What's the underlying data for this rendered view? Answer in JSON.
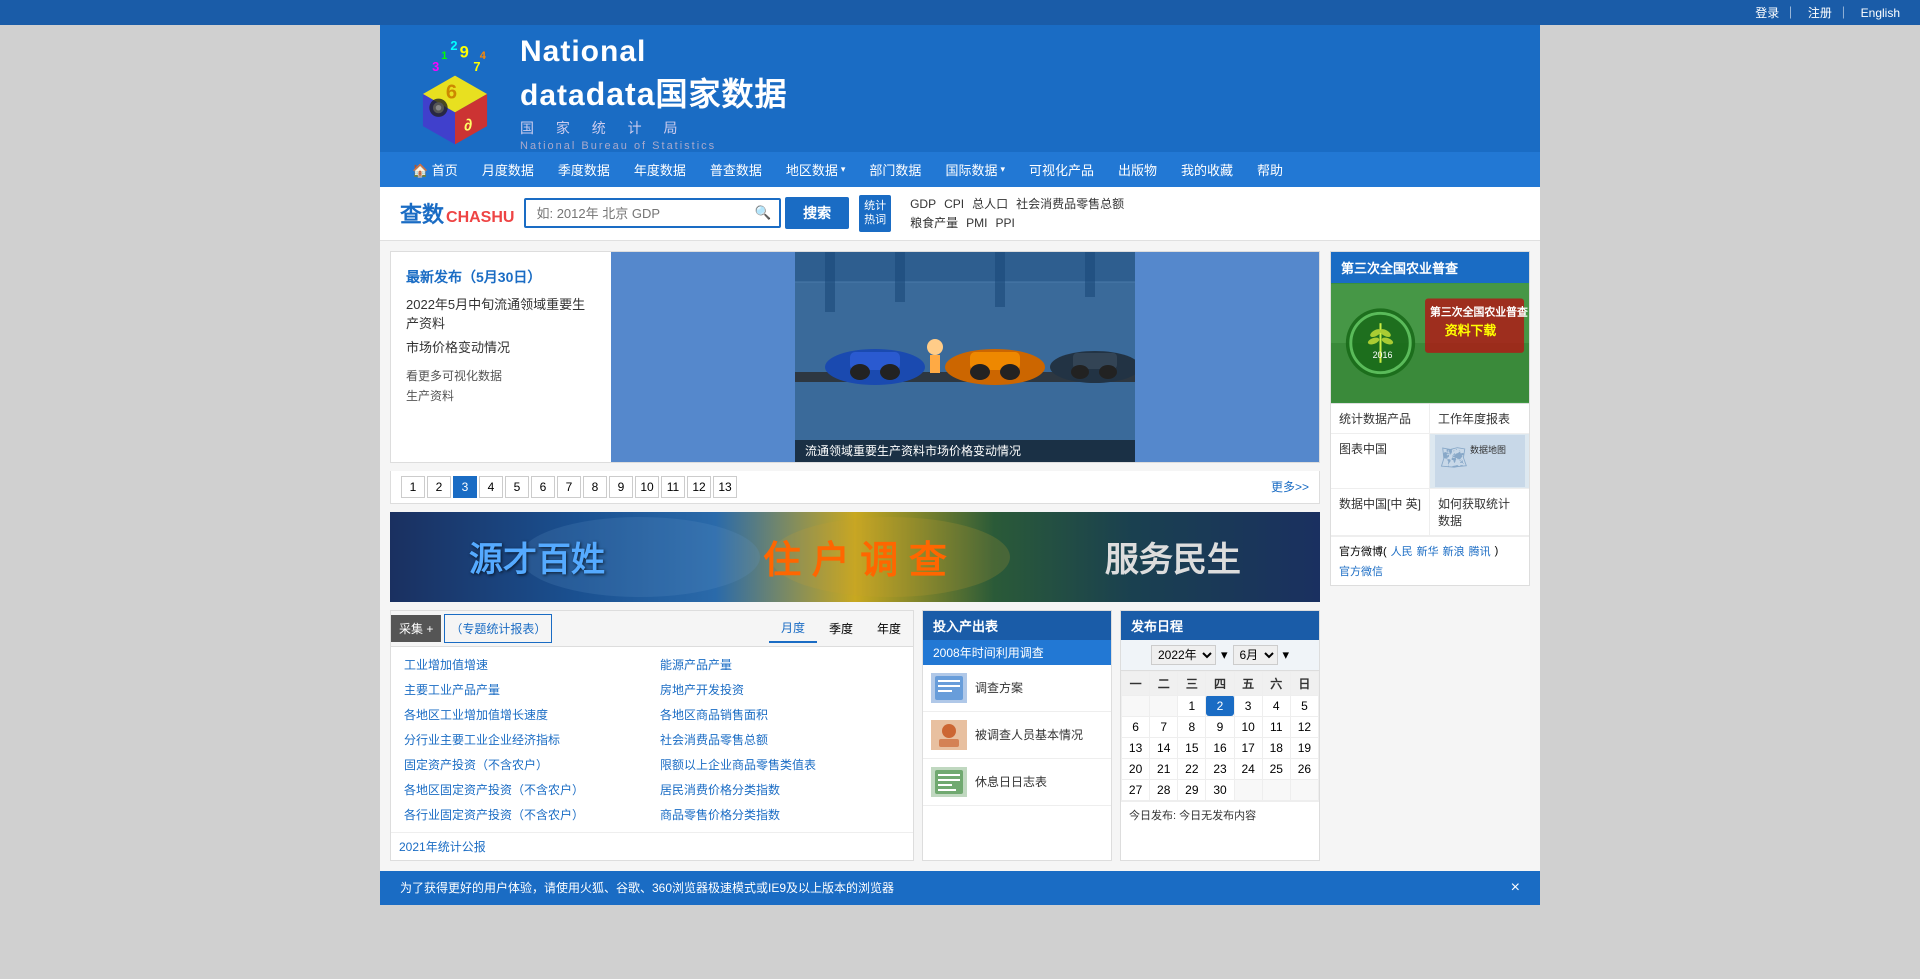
{
  "topbar": {
    "login": "登录",
    "register": "注册",
    "divider1": "｜",
    "divider2": "｜",
    "english": "English"
  },
  "header": {
    "logo_line1": "National",
    "logo_line2": "data国家数据",
    "logo_line3": "国 家 统 计 局",
    "logo_line4": "National Bureau of Statistics"
  },
  "nav": {
    "items": [
      {
        "label": "🏠 首页",
        "name": "home"
      },
      {
        "label": "月度数据",
        "name": "monthly"
      },
      {
        "label": "季度数据",
        "name": "quarterly"
      },
      {
        "label": "年度数据",
        "name": "annual"
      },
      {
        "label": "普查数据",
        "name": "census"
      },
      {
        "label": "地区数据 ▾",
        "name": "regional"
      },
      {
        "label": "部门数据",
        "name": "dept"
      },
      {
        "label": "国际数据 ▾",
        "name": "international"
      },
      {
        "label": "可视化产品",
        "name": "visual"
      },
      {
        "label": "出版物",
        "name": "publications"
      },
      {
        "label": "我的收藏",
        "name": "favorites"
      },
      {
        "label": "帮助",
        "name": "help"
      }
    ]
  },
  "search": {
    "chashu": "查数",
    "chashu_en": "CHASHU",
    "placeholder": "如: 2012年 北京 GDP",
    "button": "搜索",
    "hot_label": "统计\n热词",
    "hot_tags_row1": [
      "GDP",
      "CPI",
      "总人口",
      "社会消费品零售总额"
    ],
    "hot_tags_row2": [
      "粮食产量",
      "PMI",
      "PPI"
    ]
  },
  "news": {
    "date": "最新发布（5月30日）",
    "title1": "2022年5月中旬流通领域重要生产资料",
    "title2": "市场价格变动情况",
    "link1": "看更多可视化数据",
    "link2": "生产资料",
    "caption": "流通领域重要生产资料市场价格变动情况",
    "pages": [
      "1",
      "2",
      "3",
      "4",
      "5",
      "6",
      "7",
      "8",
      "9",
      "10",
      "11",
      "12",
      "13"
    ],
    "active_page": "3",
    "more": "更多>>"
  },
  "banner": {
    "text1": "源才百姓",
    "text2": "住 户 调 查",
    "text3": "服务民生"
  },
  "stats_table": {
    "special_btn": "采集 +",
    "special_label": "（专题统计报表）",
    "tabs": [
      "月度",
      "季度",
      "年度"
    ],
    "active_tab": "月度",
    "items_left": [
      "工业增加值增速",
      "主要工业产品产量",
      "各地区工业增加值增长速度",
      "分行业主要工业企业经济指标",
      "固定资产投资（不含农户）",
      "各地区固定资产投资（不含农户）",
      "各行业固定资产投资（不含农户）"
    ],
    "items_right": [
      "能源产品产量",
      "房地产开发投资",
      "各地区商品销售面积",
      "社会消费品零售总额",
      "限额以上企业商品零售类值表",
      "居民消费价格分类指数",
      "商品零售价格分类指数"
    ]
  },
  "input_output": {
    "header": "投入产出表",
    "survey_bar": "2008年时间利用调查",
    "items": [
      {
        "label": "调查方案"
      },
      {
        "label": "被调查人员基本情况"
      },
      {
        "label": "休息日日志表"
      }
    ]
  },
  "calendar": {
    "header": "发布日程",
    "year": "2022年",
    "month": "6月",
    "weekdays": [
      "一",
      "二",
      "三",
      "四",
      "五",
      "六",
      "日"
    ],
    "weeks": [
      [
        "",
        "",
        "1",
        "2",
        "3",
        "4",
        "5"
      ],
      [
        "6",
        "7",
        "8",
        "9",
        "10",
        "11",
        "12"
      ],
      [
        "13",
        "14",
        "15",
        "16",
        "17",
        "18",
        "19"
      ],
      [
        "20",
        "21",
        "22",
        "23",
        "24",
        "25",
        "26"
      ],
      [
        "27",
        "28",
        "29",
        "30",
        "",
        "",
        ""
      ]
    ],
    "today": "2",
    "footer": "今日发布: 今日无发布内容"
  },
  "sidebar": {
    "title": "第三次全国农业普查",
    "image_text": "第三次全国农业普查\n资料下载",
    "image_year": "2016",
    "links": [
      "统计数据产品",
      "工作年度报表",
      "图表中国",
      "数据中国[中 英]",
      "如何获取统计数据",
      ""
    ],
    "weibo_label": "官方微博(人民 新华 新浪 腾讯) 官方微信",
    "weibo_items": [
      "人民",
      "新华",
      "新浪",
      "腾讯"
    ]
  },
  "notification": {
    "text": "为了获得更好的用户体验，请使用火狐、谷歌、360浏览器极速模式或IE9及以上版本的浏览器",
    "close": "×"
  }
}
